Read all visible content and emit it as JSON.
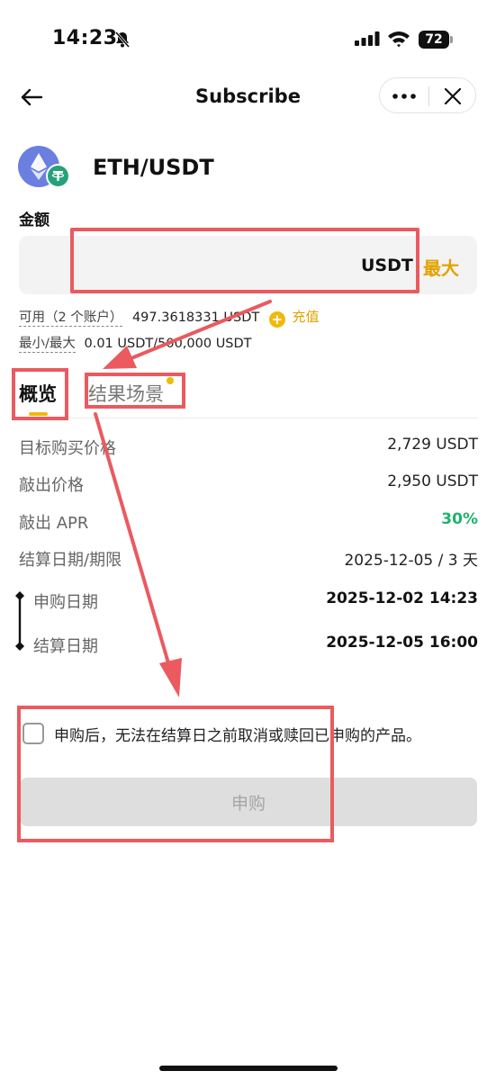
{
  "status_bar": {
    "time": "14:23",
    "battery": "72"
  },
  "nav": {
    "title": "Subscribe"
  },
  "pair": {
    "name": "ETH/USDT",
    "base_icon": "eth-icon",
    "quote_icon": "usdt-icon"
  },
  "amount": {
    "label": "金额",
    "value": "",
    "unit": "USDT",
    "max_label": "最大"
  },
  "available": {
    "label": "可用（2 个账户）",
    "value": "497.3618331 USDT",
    "recharge_label": "充值"
  },
  "limits": {
    "label": "最小/最大",
    "value": "0.01 USDT/500,000 USDT"
  },
  "tabs": [
    {
      "label": "概览",
      "active": true
    },
    {
      "label": "结果场景",
      "active": false
    }
  ],
  "details": [
    {
      "label": "目标购买价格",
      "value": "2,729 USDT"
    },
    {
      "label": "敲出价格",
      "value": "2,950 USDT"
    },
    {
      "label": "敲出 APR",
      "value": "30%"
    },
    {
      "label": "结算日期/期限",
      "value": "2025-12-05 / 3 天"
    }
  ],
  "timeline": [
    {
      "label": "申购日期",
      "value": "2025-12-02 14:23"
    },
    {
      "label": "结算日期",
      "value": "2025-12-05 16:00"
    }
  ],
  "agreement": {
    "text": "申购后，无法在结算日之前取消或赎回已申购的产品。",
    "checked": false
  },
  "submit": {
    "label": "申购",
    "enabled": false
  },
  "colors": {
    "accent": "#f0b90b",
    "positive": "#20b26c",
    "annotation": "#ea5a5f"
  }
}
